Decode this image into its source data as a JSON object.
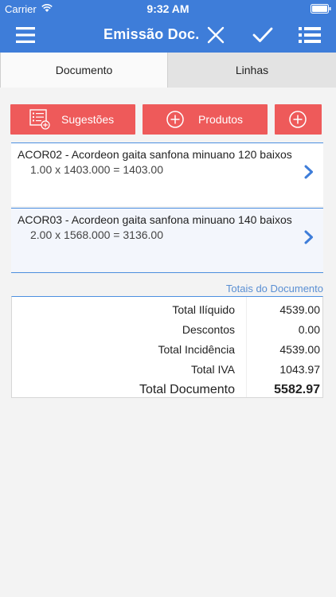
{
  "status_bar": {
    "carrier": "Carrier",
    "time": "9:32 AM",
    "wifi_icon": "wifi-icon",
    "battery_icon": "battery-icon"
  },
  "nav": {
    "title": "Emissão Doc.",
    "icons": [
      "hamburger-menu-icon",
      "close-icon",
      "checkmark-icon",
      "list-icon"
    ],
    "color": "#3e7dd9"
  },
  "tabs": [
    {
      "label": "Documento",
      "selected": true
    },
    {
      "label": "Linhas",
      "selected": false
    }
  ],
  "actions": {
    "sugestoes_label": "Sugestões",
    "produtos_label": "Produtos",
    "color": "#ee5a5a"
  },
  "lines": [
    {
      "description": "ACOR02 - Acordeon gaita sanfona minuano 120 baixos",
      "calc": "1.00 x 1403.000 = 1403.00"
    },
    {
      "description": "ACOR03 - Acordeon gaita sanfona minuano 140 baixos",
      "calc": "2.00 x 1568.000 = 3136.00"
    }
  ],
  "totals": {
    "header": "Totais do Documento",
    "rows": [
      {
        "label": "Total Ilíquido",
        "value": "4539.00"
      },
      {
        "label": "Descontos",
        "value": "0.00"
      },
      {
        "label": "Total Incidência",
        "value": "4539.00"
      },
      {
        "label": "Total IVA",
        "value": "1043.97"
      },
      {
        "label": "Total Documento",
        "value": "5582.97"
      }
    ]
  }
}
